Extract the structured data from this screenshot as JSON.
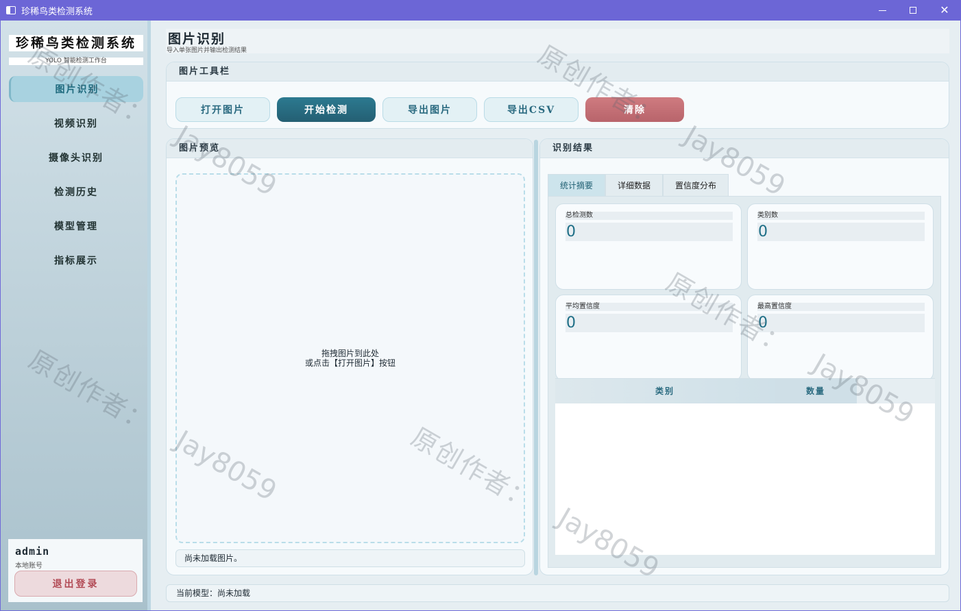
{
  "window": {
    "title": "珍稀鸟类检测系统",
    "controls": {
      "minimize": "—",
      "maximize": "",
      "close": "✕"
    }
  },
  "sidebar": {
    "brand": "珍稀鸟类检测系统",
    "brand_sub": "YOLO 智能检测工作台",
    "items": [
      {
        "label": "图片识别",
        "active": true
      },
      {
        "label": "视频识别"
      },
      {
        "label": "摄像头识别"
      },
      {
        "label": "检测历史"
      },
      {
        "label": "模型管理"
      },
      {
        "label": "指标展示"
      }
    ],
    "user": {
      "name": "admin",
      "type": "本地账号",
      "logout": "退出登录"
    }
  },
  "page": {
    "title": "图片识别",
    "subtitle": "导入单张图片并输出检测结果"
  },
  "toolbar": {
    "title": "图片工具栏",
    "buttons": {
      "open": "打开图片",
      "start": "开始检测",
      "export_image": "导出图片",
      "export_csv": "导出CSV",
      "clear": "清除"
    }
  },
  "preview": {
    "title": "图片预览",
    "drop_line1": "拖拽图片到此处",
    "drop_line2": "或点击【打开图片】按钮",
    "status": "尚未加载图片。"
  },
  "results": {
    "title": "识别结果",
    "tabs": [
      "统计摘要",
      "详细数据",
      "置信度分布"
    ],
    "stats": [
      {
        "label": "总检测数",
        "value": "0"
      },
      {
        "label": "类别数",
        "value": "0"
      },
      {
        "label": "平均置信度",
        "value": "0"
      },
      {
        "label": "最高置信度",
        "value": "0"
      }
    ],
    "table_headers": [
      "类别",
      "数量"
    ]
  },
  "statusbar": {
    "text": "当前模型：尚未加载"
  },
  "watermark": {
    "author": "原创作者：",
    "id": "Jay8059"
  }
}
